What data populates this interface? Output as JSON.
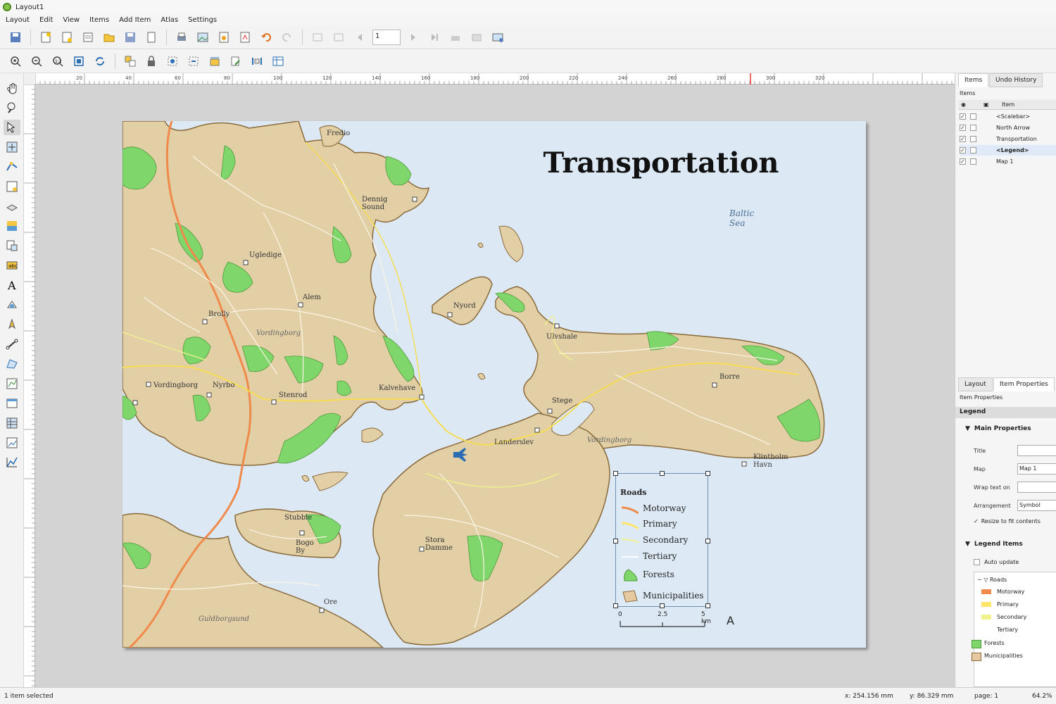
{
  "window": {
    "title": "Layout1"
  },
  "menu": [
    "Layout",
    "Edit",
    "View",
    "Items",
    "Add Item",
    "Atlas",
    "Settings"
  ],
  "toolbar": {
    "page_value": "1"
  },
  "ruler": {
    "h_ticks": [
      "20",
      "40",
      "60",
      "80",
      "100",
      "120",
      "140",
      "160",
      "180",
      "200",
      "220",
      "240",
      "260",
      "280",
      "300",
      "320"
    ]
  },
  "map": {
    "title": "Transportation",
    "sea_label": "Baltic Sea",
    "places": {
      "p1": "Fredio",
      "p2": "Dennig Sound",
      "p3": "Ugledige",
      "p4": "Alem",
      "p5": "Brolly",
      "p6": "Vordingborg",
      "p7": "Vordingborg",
      "p8": "Nyrbo",
      "p9": "Stenrod",
      "p10": "Kalvehave",
      "p11": "Nyord",
      "p12": "Ulvshale",
      "p13": "Borre",
      "p14": "Stege",
      "p15": "Landerslev",
      "p16": "Vordingborg",
      "p17": "Klintholm Havn",
      "p18": "Stubble",
      "p19": "Bogo By",
      "p20": "Stora Damme",
      "p21": "Ore",
      "p22": "Guldborgsund"
    },
    "legend": {
      "heading": "Roads",
      "items": [
        "Motorway",
        "Primary",
        "Secondary",
        "Tertiary",
        "Forests",
        "Municipalities"
      ],
      "colors": [
        "#f08a4b",
        "#ffe66a",
        "#f2f28c",
        "#ffffff",
        "#7fd66a",
        "#e6c9a0"
      ]
    },
    "scale": {
      "t0": "0",
      "t1": "2.5",
      "t2": "5 km"
    },
    "north": "A"
  },
  "right_panel": {
    "tabs": [
      "Items",
      "Undo History"
    ],
    "items_label": "Items",
    "col_item": "Item",
    "items": [
      "<Scalebar>",
      "North Arrow",
      "Transportation",
      "<Legend>",
      "Map 1"
    ],
    "bottom_tabs": [
      "Layout",
      "Item Properties"
    ],
    "section_item_props": "Item Properties",
    "legend_header": "Legend",
    "main_props": "Main Properties",
    "title_label": "Title",
    "map_label": "Map",
    "map_value": "Map 1",
    "wrap_label": "Wrap text on",
    "arrangement_label": "Arrangement",
    "arrangement_value": "Symbol",
    "resize_label": "Resize to fit contents",
    "legend_items_label": "Legend Items",
    "auto_update_label": "Auto update",
    "tree": [
      "Roads",
      "Motorway",
      "Primary",
      "Secondary",
      "Tertiary",
      "Forests",
      "Municipalities"
    ]
  },
  "status": {
    "left": "1 item selected",
    "x": "x: 254.156 mm",
    "y": "y: 86.329 mm",
    "page": "page: 1",
    "zoom": "64.2%"
  }
}
